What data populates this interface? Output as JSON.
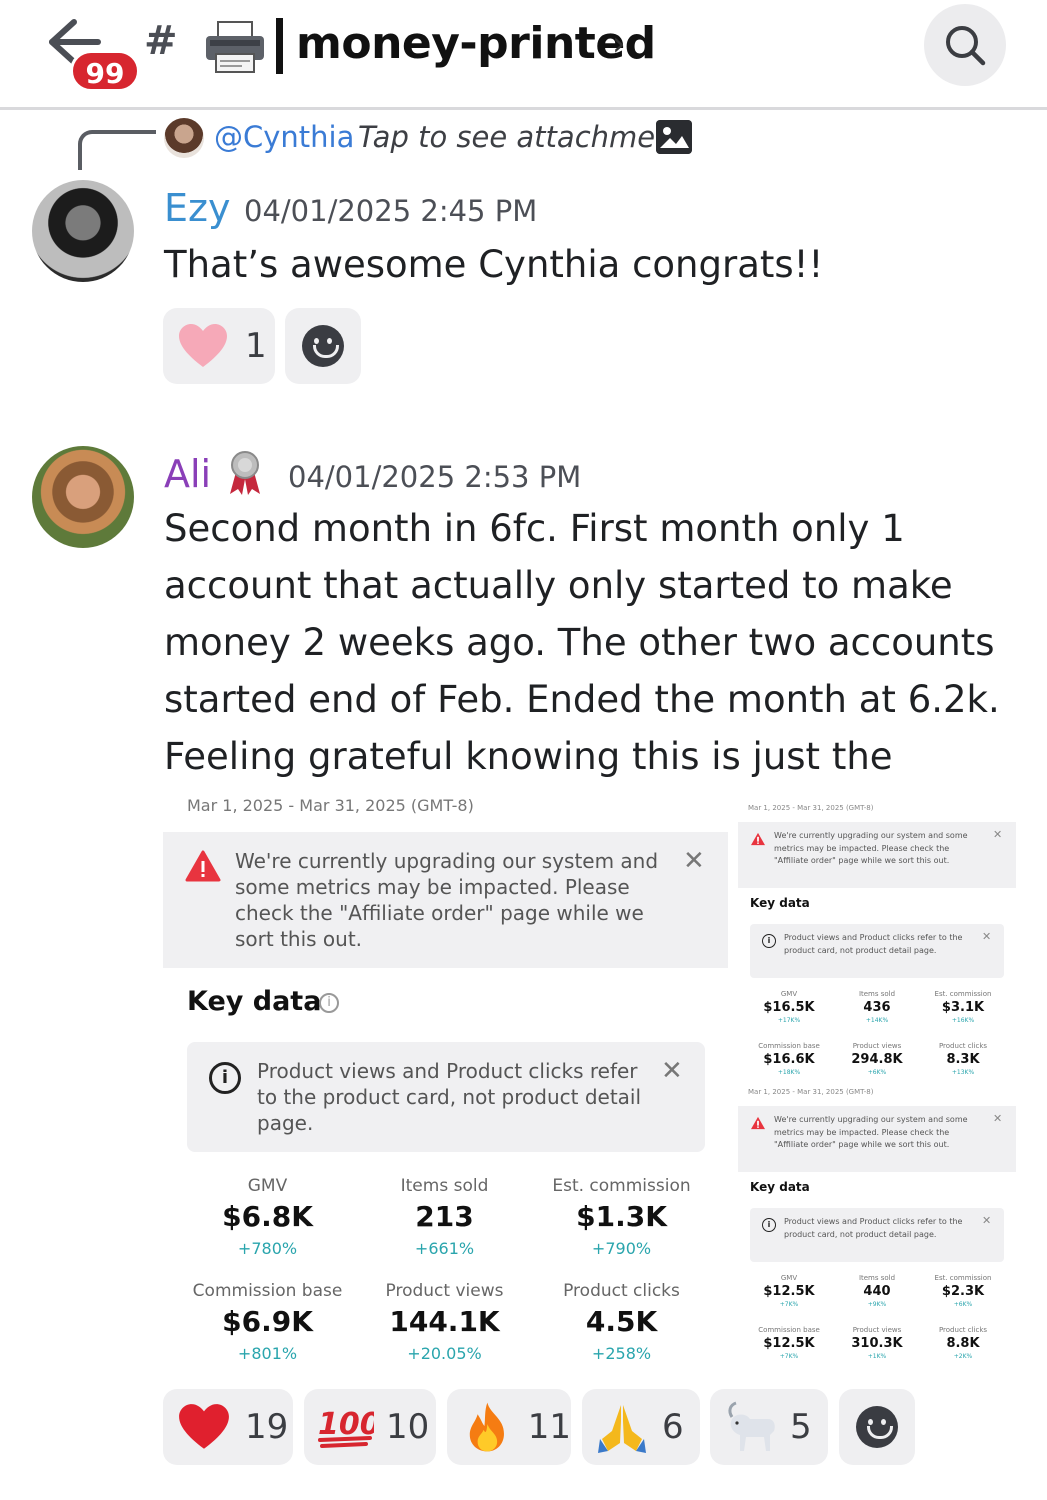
{
  "header": {
    "back_badge": "99",
    "channel_name": "money-printed",
    "channel_prefix": "#"
  },
  "reply": {
    "user": "@Cynthia",
    "text": "Tap to see attachment"
  },
  "messages": [
    {
      "author": "Ezy",
      "timestamp": "04/01/2025 2:45 PM",
      "text": "That’s awesome Cynthia congrats!!",
      "reactions": [
        {
          "icon": "pink-heart-icon",
          "count": "1"
        }
      ]
    },
    {
      "author": "Ali",
      "timestamp": "04/01/2025 2:53 PM",
      "text": "Second month in 6fc. First month only 1 account that actually only started to make money 2 weeks ago. The other two accounts started end of Feb. Ended the month at 6.2k. Feeling grateful knowing this is just the beginning !",
      "reactions": [
        {
          "icon": "red-heart-icon",
          "count": "19"
        },
        {
          "icon": "hundred-points-icon",
          "count": "10"
        },
        {
          "icon": "fire-icon",
          "count": "11"
        },
        {
          "icon": "folded-hands-icon",
          "count": "6"
        },
        {
          "icon": "goat-icon",
          "count": "5"
        }
      ]
    }
  ],
  "attachment_main": {
    "date_range": "Mar 1, 2025 - Mar 31, 2025 (GMT-8)",
    "warning": "We're currently upgrading our system and some metrics may be impacted. Please check the \"Affiliate order\" page while we sort this out.",
    "key_data_title": "Key data",
    "info_text": "Product views and Product clicks refer to the product card, not product detail page.",
    "metrics": [
      {
        "label": "GMV",
        "value": "$6.8K",
        "change": "+780%"
      },
      {
        "label": "Items sold",
        "value": "213",
        "change": "+661%"
      },
      {
        "label": "Est. commission",
        "value": "$1.3K",
        "change": "+790%"
      },
      {
        "label": "Commission base",
        "value": "$6.9K",
        "change": "+801%"
      },
      {
        "label": "Product views",
        "value": "144.1K",
        "change": "+20.05%"
      },
      {
        "label": "Product clicks",
        "value": "4.5K",
        "change": "+258%"
      }
    ]
  },
  "attachment_small_1": {
    "date_range": "Mar 1, 2025 - Mar 31, 2025 (GMT-8)",
    "warning": "We're currently upgrading our system and some metrics may be impacted. Please check the \"Affiliate order\" page while we sort this out.",
    "key_data_title": "Key data",
    "info_text": "Product views and Product clicks refer to the product card, not product detail page.",
    "metrics": [
      {
        "label": "GMV",
        "value": "$16.5K",
        "change": "+17K%"
      },
      {
        "label": "Items sold",
        "value": "436",
        "change": "+14K%"
      },
      {
        "label": "Est. commission",
        "value": "$3.1K",
        "change": "+16K%"
      },
      {
        "label": "Commission base",
        "value": "$16.6K",
        "change": "+18K%"
      },
      {
        "label": "Product views",
        "value": "294.8K",
        "change": "+6K%"
      },
      {
        "label": "Product clicks",
        "value": "8.3K",
        "change": "+13K%"
      }
    ]
  },
  "attachment_small_2": {
    "date_range": "Mar 1, 2025 - Mar 31, 2025 (GMT-8)",
    "warning": "We're currently upgrading our system and some metrics may be impacted. Please check the \"Affiliate order\" page while we sort this out.",
    "key_data_title": "Key data",
    "info_text": "Product views and Product clicks refer to the product card, not product detail page.",
    "metrics": [
      {
        "label": "GMV",
        "value": "$12.5K",
        "change": "+7K%"
      },
      {
        "label": "Items sold",
        "value": "440",
        "change": "+9K%"
      },
      {
        "label": "Est. commission",
        "value": "$2.3K",
        "change": "+6K%"
      },
      {
        "label": "Commission base",
        "value": "$12.5K",
        "change": "+7K%"
      },
      {
        "label": "Product views",
        "value": "310.3K",
        "change": "+1K%"
      },
      {
        "label": "Product clicks",
        "value": "8.8K",
        "change": "+2K%"
      }
    ]
  },
  "colors": {
    "ezy_name": "#3a8fd0",
    "ali_name": "#8a3fb8",
    "mention": "#3a7bd5",
    "badge": "#d7262f",
    "change_teal": "#2aa5ad"
  }
}
